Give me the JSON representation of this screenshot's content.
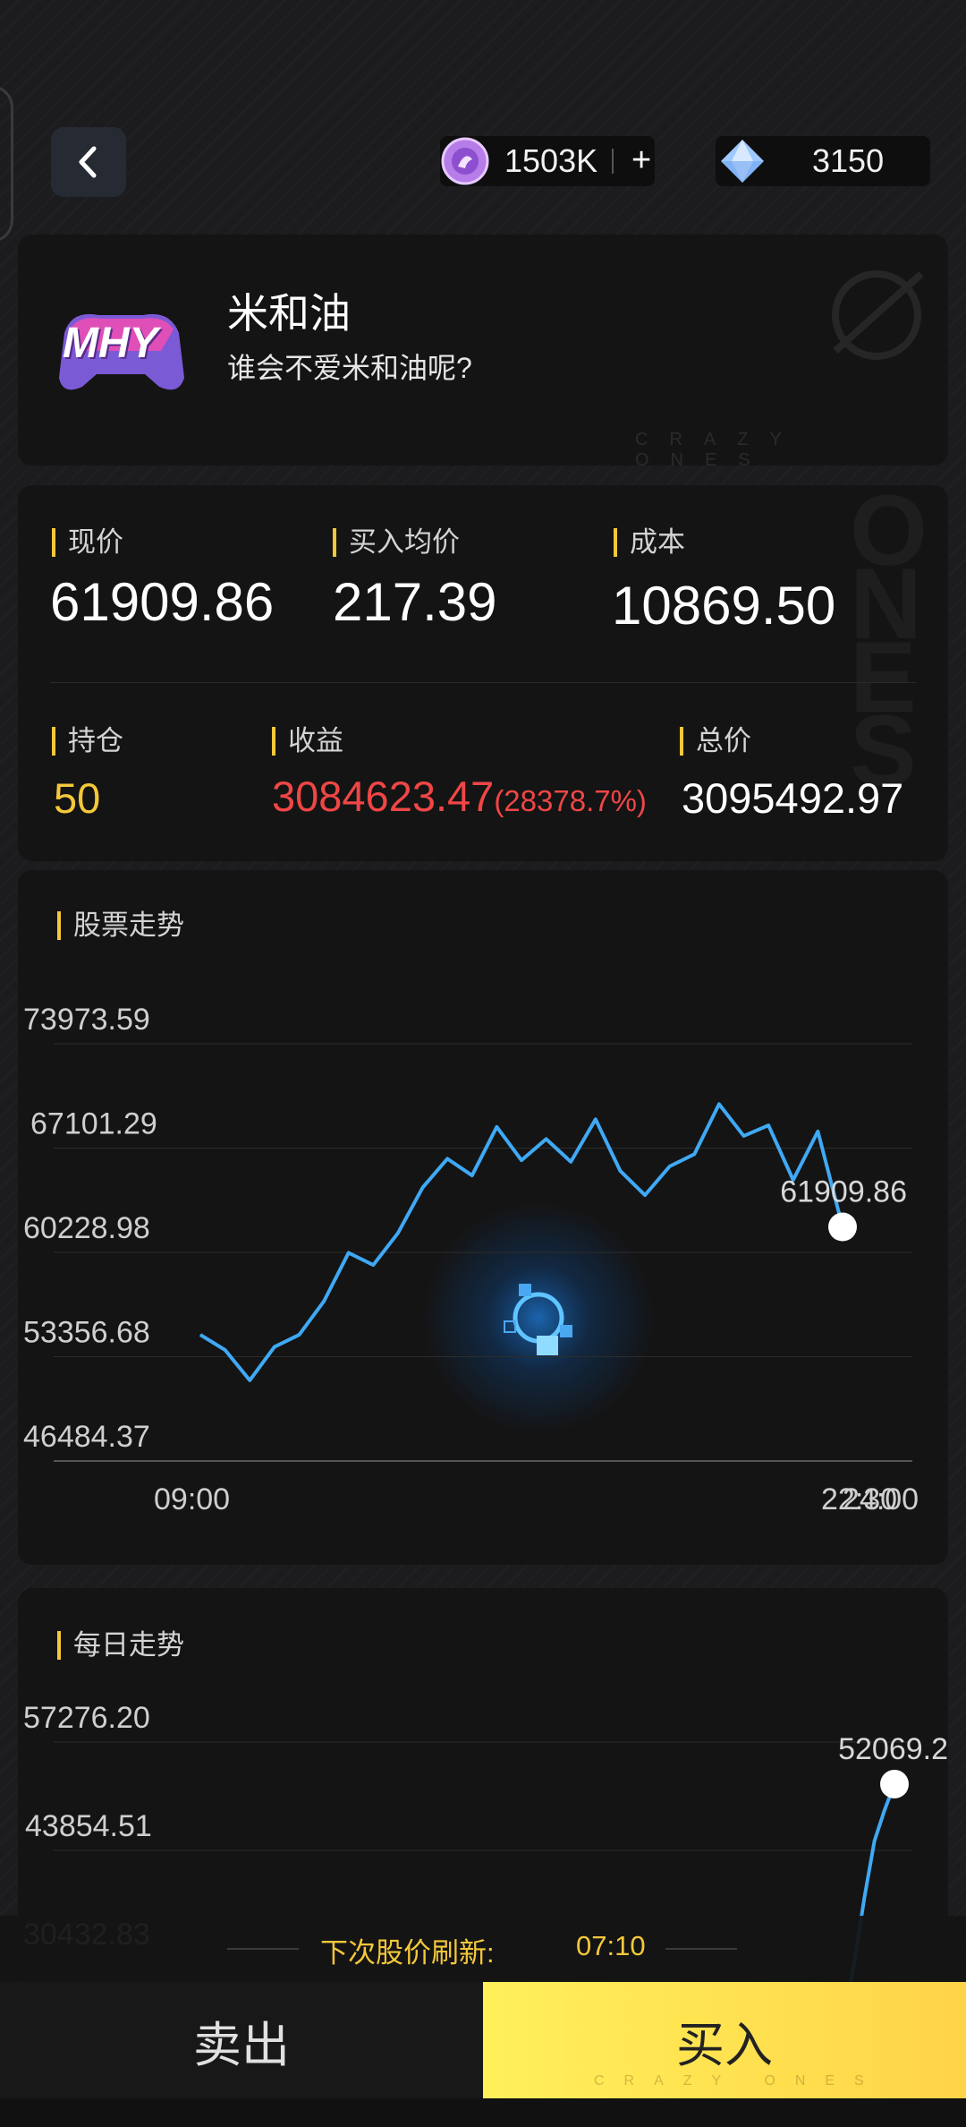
{
  "topbar": {
    "coin_value": "1503K",
    "gem_value": "3150"
  },
  "profile": {
    "logo_text": "MHY",
    "name": "米和油",
    "subtitle": "谁会不爱米和油呢?",
    "watermark": "CRAZY ONES"
  },
  "stats": {
    "current_price_label": "现价",
    "current_price": "61909.86",
    "avg_buy_label": "买入均价",
    "avg_buy": "217.39",
    "cost_label": "成本",
    "cost": "10869.50",
    "holding_label": "持仓",
    "holding": "50",
    "profit_label": "收益",
    "profit": "3084623.47",
    "profit_pct": "(28378.7%)",
    "total_label": "总价",
    "total": "3095492.97"
  },
  "colors": {
    "accent_yellow": "#f5c83a",
    "profit_red": "#f04646",
    "line_blue": "#3fa9f5",
    "buy_yellow": "#ffe14f"
  },
  "chart_data": [
    {
      "type": "line",
      "title": "股票走势",
      "yticks": [
        "73973.59",
        "67101.29",
        "60228.98",
        "53356.68",
        "46484.37"
      ],
      "ylim": [
        46484.37,
        73973.59
      ],
      "xtick_labels": [
        "09:00",
        "22:30",
        "24:00"
      ],
      "x": [
        0,
        1,
        2,
        3,
        4,
        5,
        6,
        7,
        8,
        9,
        10,
        11,
        12,
        13,
        14,
        15,
        16,
        17,
        18,
        19,
        20,
        21,
        22,
        23,
        24,
        25,
        26
      ],
      "values": [
        54800,
        53800,
        51800,
        54000,
        54800,
        57000,
        60200,
        59400,
        61500,
        64500,
        66400,
        65300,
        68500,
        66300,
        67700,
        66200,
        69000,
        65600,
        64000,
        65900,
        66700,
        70000,
        67900,
        68600,
        65000,
        68200,
        61909.86
      ],
      "last_label": "61909.86",
      "grid": true
    },
    {
      "type": "line",
      "title": "每日走势",
      "yticks": [
        "57276.20",
        "43854.51",
        "30432.83"
      ],
      "ylim": [
        30432.83,
        57276.2
      ],
      "x": [
        0,
        1,
        2,
        3,
        4,
        5
      ],
      "values": [
        23000,
        30000,
        38000,
        45000,
        48800,
        52069.2
      ],
      "last_label": "52069.2",
      "grid": true
    }
  ],
  "footer": {
    "refresh_label": "下次股价刷新:",
    "refresh_time": "07:10",
    "sell_label": "卖出",
    "buy_label": "买入",
    "watermark": "CRAZY ONES"
  }
}
